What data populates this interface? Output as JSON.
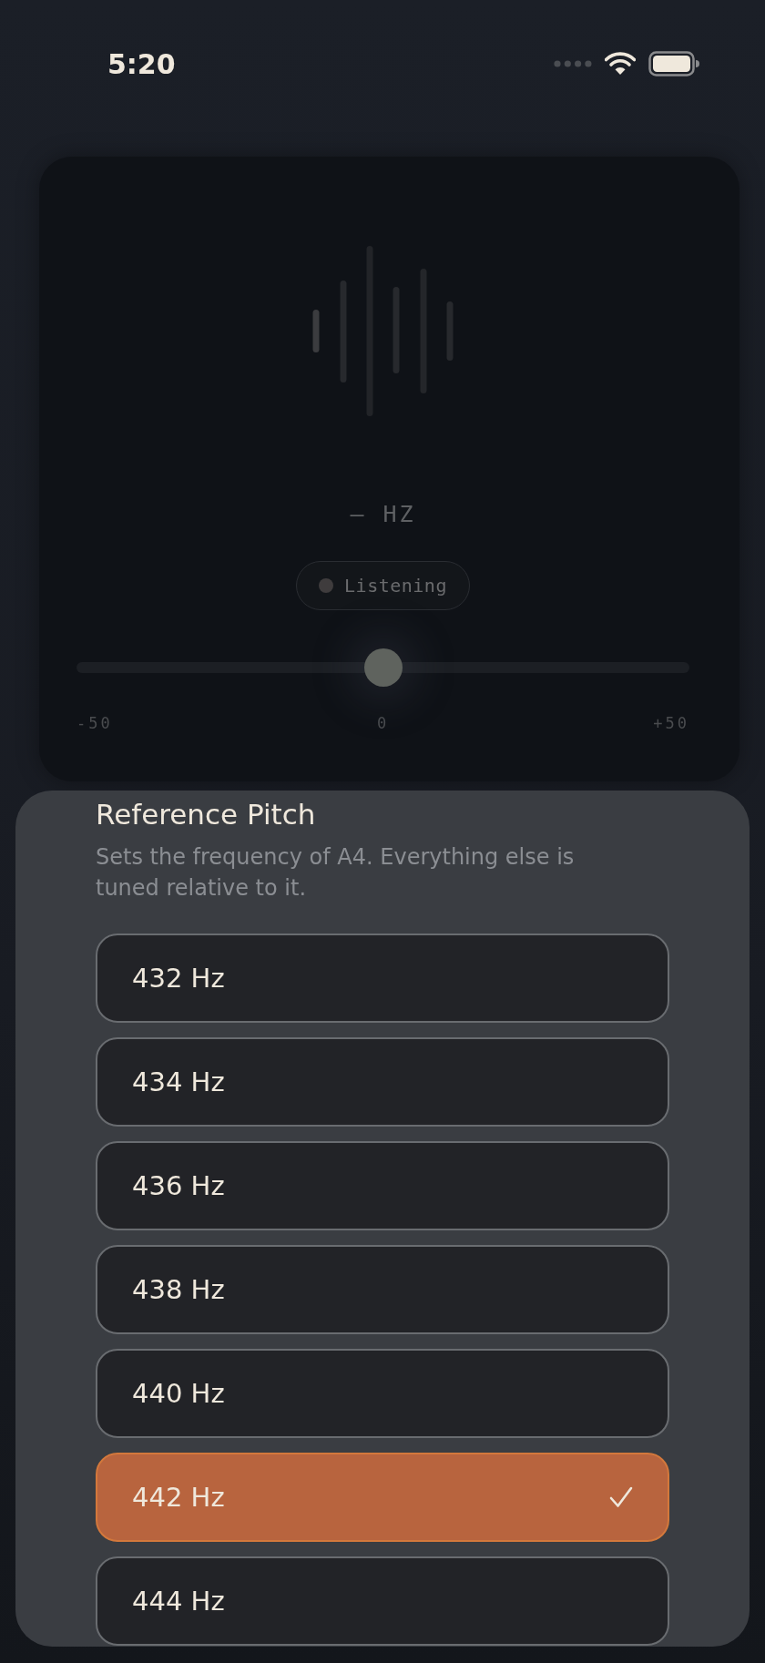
{
  "status_bar": {
    "time": "5:20"
  },
  "tuner": {
    "frequency": "— HZ",
    "status": "Listening",
    "meter": {
      "level": 0.5,
      "ticks": [
        "-50",
        "0",
        "+50"
      ]
    }
  },
  "sheet": {
    "title": "Reference Pitch",
    "description": "Sets the frequency of A4. Everything else is tuned relative to it.",
    "options": [
      {
        "label": "432 Hz",
        "selected": false
      },
      {
        "label": "434 Hz",
        "selected": false
      },
      {
        "label": "436 Hz",
        "selected": false
      },
      {
        "label": "438 Hz",
        "selected": false
      },
      {
        "label": "440 Hz",
        "selected": false
      },
      {
        "label": "442 Hz",
        "selected": true
      },
      {
        "label": "444 Hz",
        "selected": false
      }
    ]
  }
}
